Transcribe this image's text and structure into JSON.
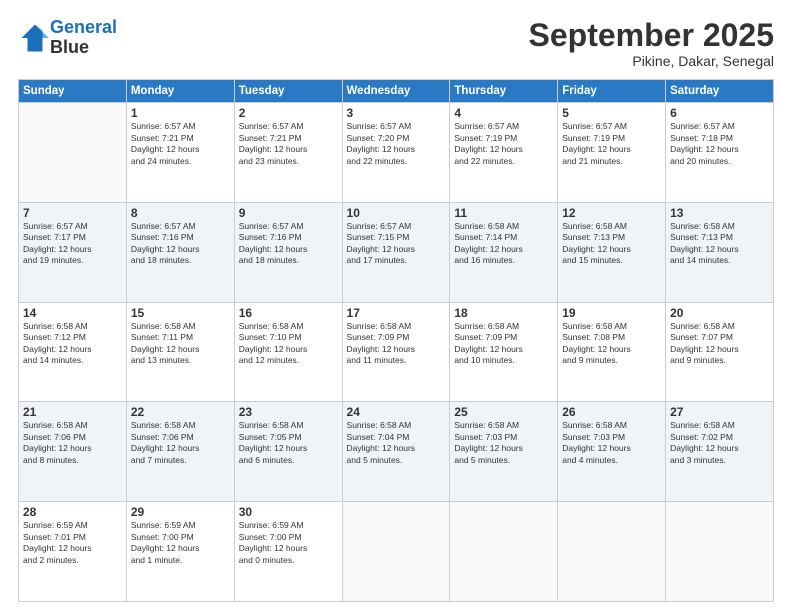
{
  "logo": {
    "line1": "General",
    "line2": "Blue"
  },
  "title": "September 2025",
  "subtitle": "Pikine, Dakar, Senegal",
  "weekdays": [
    "Sunday",
    "Monday",
    "Tuesday",
    "Wednesday",
    "Thursday",
    "Friday",
    "Saturday"
  ],
  "weeks": [
    [
      {
        "day": "",
        "info": ""
      },
      {
        "day": "1",
        "info": "Sunrise: 6:57 AM\nSunset: 7:21 PM\nDaylight: 12 hours\nand 24 minutes."
      },
      {
        "day": "2",
        "info": "Sunrise: 6:57 AM\nSunset: 7:21 PM\nDaylight: 12 hours\nand 23 minutes."
      },
      {
        "day": "3",
        "info": "Sunrise: 6:57 AM\nSunset: 7:20 PM\nDaylight: 12 hours\nand 22 minutes."
      },
      {
        "day": "4",
        "info": "Sunrise: 6:57 AM\nSunset: 7:19 PM\nDaylight: 12 hours\nand 22 minutes."
      },
      {
        "day": "5",
        "info": "Sunrise: 6:57 AM\nSunset: 7:19 PM\nDaylight: 12 hours\nand 21 minutes."
      },
      {
        "day": "6",
        "info": "Sunrise: 6:57 AM\nSunset: 7:18 PM\nDaylight: 12 hours\nand 20 minutes."
      }
    ],
    [
      {
        "day": "7",
        "info": "Sunrise: 6:57 AM\nSunset: 7:17 PM\nDaylight: 12 hours\nand 19 minutes."
      },
      {
        "day": "8",
        "info": "Sunrise: 6:57 AM\nSunset: 7:16 PM\nDaylight: 12 hours\nand 18 minutes."
      },
      {
        "day": "9",
        "info": "Sunrise: 6:57 AM\nSunset: 7:16 PM\nDaylight: 12 hours\nand 18 minutes."
      },
      {
        "day": "10",
        "info": "Sunrise: 6:57 AM\nSunset: 7:15 PM\nDaylight: 12 hours\nand 17 minutes."
      },
      {
        "day": "11",
        "info": "Sunrise: 6:58 AM\nSunset: 7:14 PM\nDaylight: 12 hours\nand 16 minutes."
      },
      {
        "day": "12",
        "info": "Sunrise: 6:58 AM\nSunset: 7:13 PM\nDaylight: 12 hours\nand 15 minutes."
      },
      {
        "day": "13",
        "info": "Sunrise: 6:58 AM\nSunset: 7:13 PM\nDaylight: 12 hours\nand 14 minutes."
      }
    ],
    [
      {
        "day": "14",
        "info": "Sunrise: 6:58 AM\nSunset: 7:12 PM\nDaylight: 12 hours\nand 14 minutes."
      },
      {
        "day": "15",
        "info": "Sunrise: 6:58 AM\nSunset: 7:11 PM\nDaylight: 12 hours\nand 13 minutes."
      },
      {
        "day": "16",
        "info": "Sunrise: 6:58 AM\nSunset: 7:10 PM\nDaylight: 12 hours\nand 12 minutes."
      },
      {
        "day": "17",
        "info": "Sunrise: 6:58 AM\nSunset: 7:09 PM\nDaylight: 12 hours\nand 11 minutes."
      },
      {
        "day": "18",
        "info": "Sunrise: 6:58 AM\nSunset: 7:09 PM\nDaylight: 12 hours\nand 10 minutes."
      },
      {
        "day": "19",
        "info": "Sunrise: 6:58 AM\nSunset: 7:08 PM\nDaylight: 12 hours\nand 9 minutes."
      },
      {
        "day": "20",
        "info": "Sunrise: 6:58 AM\nSunset: 7:07 PM\nDaylight: 12 hours\nand 9 minutes."
      }
    ],
    [
      {
        "day": "21",
        "info": "Sunrise: 6:58 AM\nSunset: 7:06 PM\nDaylight: 12 hours\nand 8 minutes."
      },
      {
        "day": "22",
        "info": "Sunrise: 6:58 AM\nSunset: 7:06 PM\nDaylight: 12 hours\nand 7 minutes."
      },
      {
        "day": "23",
        "info": "Sunrise: 6:58 AM\nSunset: 7:05 PM\nDaylight: 12 hours\nand 6 minutes."
      },
      {
        "day": "24",
        "info": "Sunrise: 6:58 AM\nSunset: 7:04 PM\nDaylight: 12 hours\nand 5 minutes."
      },
      {
        "day": "25",
        "info": "Sunrise: 6:58 AM\nSunset: 7:03 PM\nDaylight: 12 hours\nand 5 minutes."
      },
      {
        "day": "26",
        "info": "Sunrise: 6:58 AM\nSunset: 7:03 PM\nDaylight: 12 hours\nand 4 minutes."
      },
      {
        "day": "27",
        "info": "Sunrise: 6:58 AM\nSunset: 7:02 PM\nDaylight: 12 hours\nand 3 minutes."
      }
    ],
    [
      {
        "day": "28",
        "info": "Sunrise: 6:59 AM\nSunset: 7:01 PM\nDaylight: 12 hours\nand 2 minutes."
      },
      {
        "day": "29",
        "info": "Sunrise: 6:59 AM\nSunset: 7:00 PM\nDaylight: 12 hours\nand 1 minute."
      },
      {
        "day": "30",
        "info": "Sunrise: 6:59 AM\nSunset: 7:00 PM\nDaylight: 12 hours\nand 0 minutes."
      },
      {
        "day": "",
        "info": ""
      },
      {
        "day": "",
        "info": ""
      },
      {
        "day": "",
        "info": ""
      },
      {
        "day": "",
        "info": ""
      }
    ]
  ]
}
